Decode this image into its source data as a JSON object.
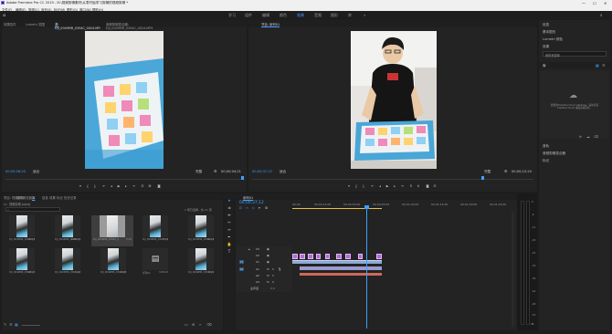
{
  "window": {
    "title": "Adobe Premiere Pro CC 2019 - D:\\视频剪辑素材\\从零开始学习剪辑的视频剪辑 *",
    "controls": [
      "—",
      "☐",
      "✕"
    ]
  },
  "menu": [
    "文件(F)",
    "编辑(E)",
    "剪辑(C)",
    "序列(S)",
    "标记(M)",
    "图形(G)",
    "窗口(W)",
    "帮助(H)"
  ],
  "workspaces": {
    "items": [
      "学习",
      "组件",
      "编辑",
      "颜色",
      "效果",
      "音频",
      "图形",
      "库"
    ],
    "active_index": 4,
    "more": "»"
  },
  "source_panel": {
    "tabs": [
      "效果控件",
      "Lumetri 范围",
      "源: DJI_0049MR_0394C_0024.MP4",
      "音频剪辑混合器: DJI_0049MR_0394C_0024.MP4"
    ],
    "active_tab": 2,
    "timecode_left": "00;00;06;20",
    "fit": "适合",
    "fraction": "完整",
    "timecode_right": "00;00;04;21"
  },
  "program_panel": {
    "tab": "节目: 序列01",
    "timecode_left": "00;00;37;12",
    "fit": "适合",
    "fraction": "完整",
    "timecode_right": "00;00;10;24"
  },
  "project_panel": {
    "tabs": [
      "项目: 视频剪辑",
      "媒体浏览器",
      "库",
      "信息",
      "效果",
      "标记",
      "历史记录"
    ],
    "active_tab": 2,
    "active_label": "项目: 视频剪辑",
    "path": "视频剪辑.prproj",
    "search_placeholder": "",
    "item_count": "1 项已选择，共 11 项",
    "items": [
      {
        "name": "DJI_0049MR_0394C_00...",
        "duration": "12:27"
      },
      {
        "name": "DJI_0049MR_0394C_00...",
        "duration": "1:00:21"
      },
      {
        "name": "DJI_0049MR_0394C_00...",
        "duration": "5:23"
      },
      {
        "name": "DJI_0049MR_0394C_00...",
        "duration": "7:11"
      },
      {
        "name": "DJI_0049MR_0394C_00...",
        "duration": "15:14"
      },
      {
        "name": "DJI_0049MR_0394C_00...",
        "duration": "10:13"
      },
      {
        "name": "DJI_0049MR_0394C_00...",
        "duration": "1:16"
      },
      {
        "name": "DJI_0049MR_0394C_00...",
        "duration": "2:08"
      },
      {
        "name": "序列01",
        "duration": "3:08:13"
      },
      {
        "name": "DJI_0049MR_0394C_00...",
        "duration": "9:20"
      }
    ]
  },
  "timeline": {
    "tab": "序列01",
    "timecode": "00;00;37;12",
    "ruler": [
      "00;00",
      "00;00;15;00",
      "00;00;30;00",
      "00;00;45;00",
      "00;01;00;00",
      "00;01;15;00",
      "00;01;30;00",
      "00;01;45;00"
    ],
    "tracks": [
      {
        "name": "V3",
        "type": "video"
      },
      {
        "name": "V2",
        "type": "video"
      },
      {
        "name": "V1",
        "type": "video"
      },
      {
        "name": "A1",
        "type": "audio"
      },
      {
        "name": "A2",
        "type": "audio"
      },
      {
        "name": "A3",
        "type": "audio"
      }
    ],
    "master": {
      "label": "主声道",
      "value": "0.0"
    },
    "meter_labels": [
      "0",
      "-6",
      "-12",
      "-18",
      "-24",
      "-30",
      "-36",
      "-42",
      "-48",
      "-54",
      "dB"
    ]
  },
  "right_panel": {
    "sections": [
      "信息",
      "基本图形",
      "Lumetri 颜色",
      "效果"
    ],
    "libraries_title": "库",
    "library_select": "我的资源库",
    "message": "要使用Creative Cloud Libraries，请先安装 Creative Cloud 桌面应用程序。",
    "bottom_items": [
      "音轨",
      "音频剪辑混合器",
      "标记"
    ]
  },
  "colors": {
    "accent": "#3fa0ff",
    "clip_video": "#8da8d8",
    "clip_audio": "#5aa86e",
    "marker": "#b56ad8",
    "panel_bg": "#232323"
  }
}
